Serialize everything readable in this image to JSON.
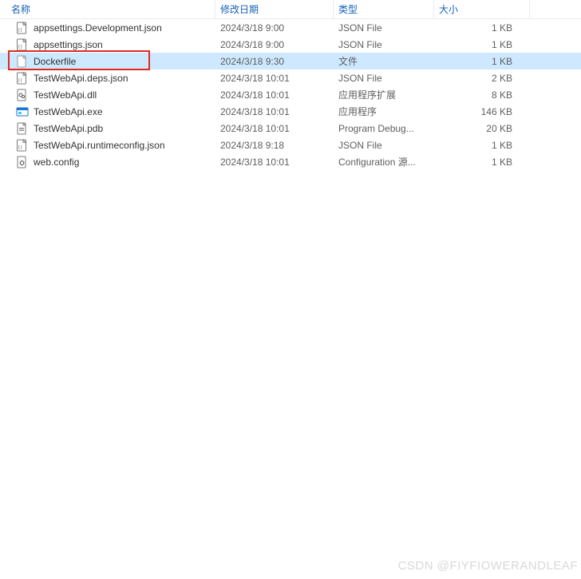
{
  "header": {
    "name": "名称",
    "date": "修改日期",
    "type": "类型",
    "size": "大小"
  },
  "files": [
    {
      "icon": "json",
      "name": "appsettings.Development.json",
      "date": "2024/3/18 9:00",
      "type": "JSON File",
      "size": "1 KB",
      "selected": false
    },
    {
      "icon": "json",
      "name": "appsettings.json",
      "date": "2024/3/18 9:00",
      "type": "JSON File",
      "size": "1 KB",
      "selected": false
    },
    {
      "icon": "blank",
      "name": "Dockerfile",
      "date": "2024/3/18 9:30",
      "type": "文件",
      "size": "1 KB",
      "selected": true
    },
    {
      "icon": "json",
      "name": "TestWebApi.deps.json",
      "date": "2024/3/18 10:01",
      "type": "JSON File",
      "size": "2 KB",
      "selected": false
    },
    {
      "icon": "dll",
      "name": "TestWebApi.dll",
      "date": "2024/3/18 10:01",
      "type": "应用程序扩展",
      "size": "8 KB",
      "selected": false
    },
    {
      "icon": "exe",
      "name": "TestWebApi.exe",
      "date": "2024/3/18 10:01",
      "type": "应用程序",
      "size": "146 KB",
      "selected": false
    },
    {
      "icon": "pdb",
      "name": "TestWebApi.pdb",
      "date": "2024/3/18 10:01",
      "type": "Program Debug...",
      "size": "20 KB",
      "selected": false
    },
    {
      "icon": "json",
      "name": "TestWebApi.runtimeconfig.json",
      "date": "2024/3/18 9:18",
      "type": "JSON File",
      "size": "1 KB",
      "selected": false
    },
    {
      "icon": "config",
      "name": "web.config",
      "date": "2024/3/18 10:01",
      "type": "Configuration 源...",
      "size": "1 KB",
      "selected": false
    }
  ],
  "highlight_index": 2,
  "watermark": "CSDN @FIYFIOWERANDLEAF"
}
